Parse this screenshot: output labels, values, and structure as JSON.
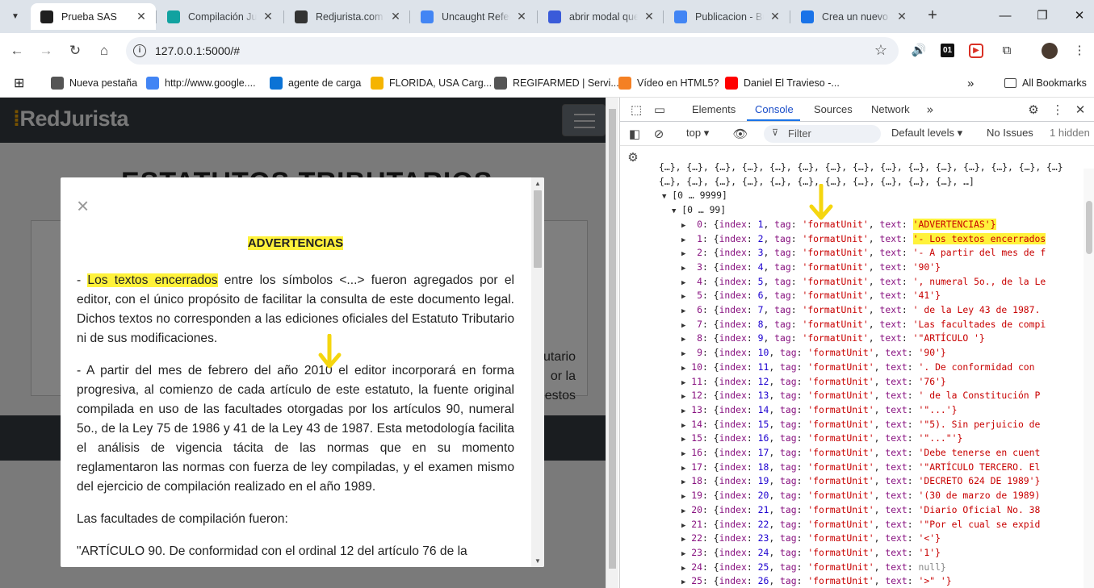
{
  "browser": {
    "tabs": [
      {
        "title": "Prueba SAS",
        "color": "#1f1f1f",
        "icon": "globe-icon"
      },
      {
        "title": "Compilación Jur",
        "color": "#11a2a0",
        "icon": "cloud-icon"
      },
      {
        "title": "Redjurista.com -",
        "color": "#333333",
        "icon": "r-logo-icon"
      },
      {
        "title": "Uncaught Refere",
        "color": "#4285f4",
        "icon": "google-icon"
      },
      {
        "title": "abrir modal que",
        "color": "#3a5bd9",
        "icon": "ai-icon"
      },
      {
        "title": "Publicacion - Bu",
        "color": "#4285f4",
        "icon": "google-icon"
      },
      {
        "title": "Crea un nuevo p",
        "color": "#1a73e8",
        "icon": "gemini-icon"
      }
    ],
    "url": "127.0.0.1:5000/#",
    "bookmarks": [
      {
        "label": "Nueva pestaña",
        "icon": "globe-icon",
        "color": "#555555"
      },
      {
        "label": "http://www.google....",
        "icon": "google-icon",
        "color": "#4285f4"
      },
      {
        "label": "agente de carga",
        "icon": "calendar-icon",
        "color": "#0b73d6"
      },
      {
        "label": "FLORIDA, USA Carg...",
        "icon": "home-icon",
        "color": "#f5b400"
      },
      {
        "label": "REGIFARMED | Servi...",
        "icon": "globe-icon",
        "color": "#555555"
      },
      {
        "label": "Vídeo en HTML5?",
        "icon": "stack-icon",
        "color": "#f48024"
      },
      {
        "label": "Daniel El Travieso -...",
        "icon": "youtube-icon",
        "color": "#ff0000"
      }
    ],
    "all_bookmarks": "All Bookmarks"
  },
  "site": {
    "logo_prefix": "Red",
    "logo_suffix": "Jurista",
    "title": "ESTATUTOS TRIBUTARIOS",
    "card_lines": [
      "utario",
      "or la",
      "estos"
    ]
  },
  "modal": {
    "heading": "ADVERTENCIAS",
    "p1_dash": "- ",
    "p1_hl": "Los textos encerrados",
    "p1_rest": " entre los símbolos <...> fueron agregados por el editor, con el único propósito de facilitar la consulta de este documento legal. Dichos textos no corresponden a las ediciones oficiales del Estatuto Tributario ni de sus modificaciones.",
    "p2": "- A partir del mes de febrero del año 2010 el editor incorporará en forma progresiva, al comienzo de cada artículo de este estatuto, la fuente original compilada en uso de las facultades otorgadas por los artículos 90, numeral 5o., de la Ley 75 de 1986 y 41 de la Ley 43 de 1987. Esta metodología facilita el análisis de vigencia tácita de las normas que en su momento reglamentaron las normas con fuerza de ley compiladas, y el examen mismo del ejercicio de compilación realizado en el año 1989.",
    "p3": "Las facultades de compilación fueron:",
    "p4": "\"ARTÍCULO 90. De conformidad con el ordinal 12 del artículo 76 de la"
  },
  "devtools": {
    "tabs": [
      "Elements",
      "Console",
      "Sources",
      "Network"
    ],
    "context": "top",
    "filter_placeholder": "Filter",
    "levels": "Default levels",
    "issues": "No Issues",
    "hidden": "1 hidden",
    "collapsed_line_1": "{…}, {…}, {…}, {…}, {…}, {…}, {…}, {…}, {…}, {…}, {…}, {…}, {…}, {…}, {…}",
    "collapsed_line_2": "{…}, {…}, {…}, {…}, {…}, {…}, {…}, {…}, {…}, {…}, {…}, …]",
    "range_outer": "[0 … 9999]",
    "range_inner": "[0 … 99]",
    "entries": [
      {
        "i": "0",
        "index": "1",
        "text": "'ADVERTENCIAS'}",
        "hl": true
      },
      {
        "i": "1",
        "index": "2",
        "text": "'- Los textos encerrados",
        "hl": true
      },
      {
        "i": "2",
        "index": "3",
        "text": "'- A partir del mes de f"
      },
      {
        "i": "3",
        "index": "4",
        "text": "'90'}"
      },
      {
        "i": "4",
        "index": "5",
        "text": "', numeral 5o., de la Le"
      },
      {
        "i": "5",
        "index": "6",
        "text": "'41'}"
      },
      {
        "i": "6",
        "index": "7",
        "text": "' de la Ley 43 de 1987."
      },
      {
        "i": "7",
        "index": "8",
        "text": "'Las facultades de compi"
      },
      {
        "i": "8",
        "index": "9",
        "text": "'\"ARTÍCULO '}"
      },
      {
        "i": "9",
        "index": "10",
        "text": "'90'}"
      },
      {
        "i": "10",
        "index": "11",
        "text": "'. De conformidad con"
      },
      {
        "i": "11",
        "index": "12",
        "text": "'76'}"
      },
      {
        "i": "12",
        "index": "13",
        "text": "' de la Constitución P"
      },
      {
        "i": "13",
        "index": "14",
        "text": "'\"...'}"
      },
      {
        "i": "14",
        "index": "15",
        "text": "'\"5). Sin perjuicio de"
      },
      {
        "i": "15",
        "index": "16",
        "text": "'\"...\"'}"
      },
      {
        "i": "16",
        "index": "17",
        "text": "'Debe tenerse en cuent"
      },
      {
        "i": "17",
        "index": "18",
        "text": "'\"ARTÍCULO TERCERO. El"
      },
      {
        "i": "18",
        "index": "19",
        "text": "'DECRETO 624 DE 1989'}"
      },
      {
        "i": "19",
        "index": "20",
        "text": "'(30 de marzo de 1989)"
      },
      {
        "i": "20",
        "index": "21",
        "text": "'Diario Oficial No. 38"
      },
      {
        "i": "21",
        "index": "22",
        "text": "'\"Por el cual se expid"
      },
      {
        "i": "22",
        "index": "23",
        "text": "'<'}"
      },
      {
        "i": "23",
        "index": "24",
        "text": "'1'}"
      },
      {
        "i": "24",
        "index": "25",
        "text": "null}",
        "isnull": true
      },
      {
        "i": "25",
        "index": "26",
        "text": "'>\" '}"
      }
    ]
  }
}
